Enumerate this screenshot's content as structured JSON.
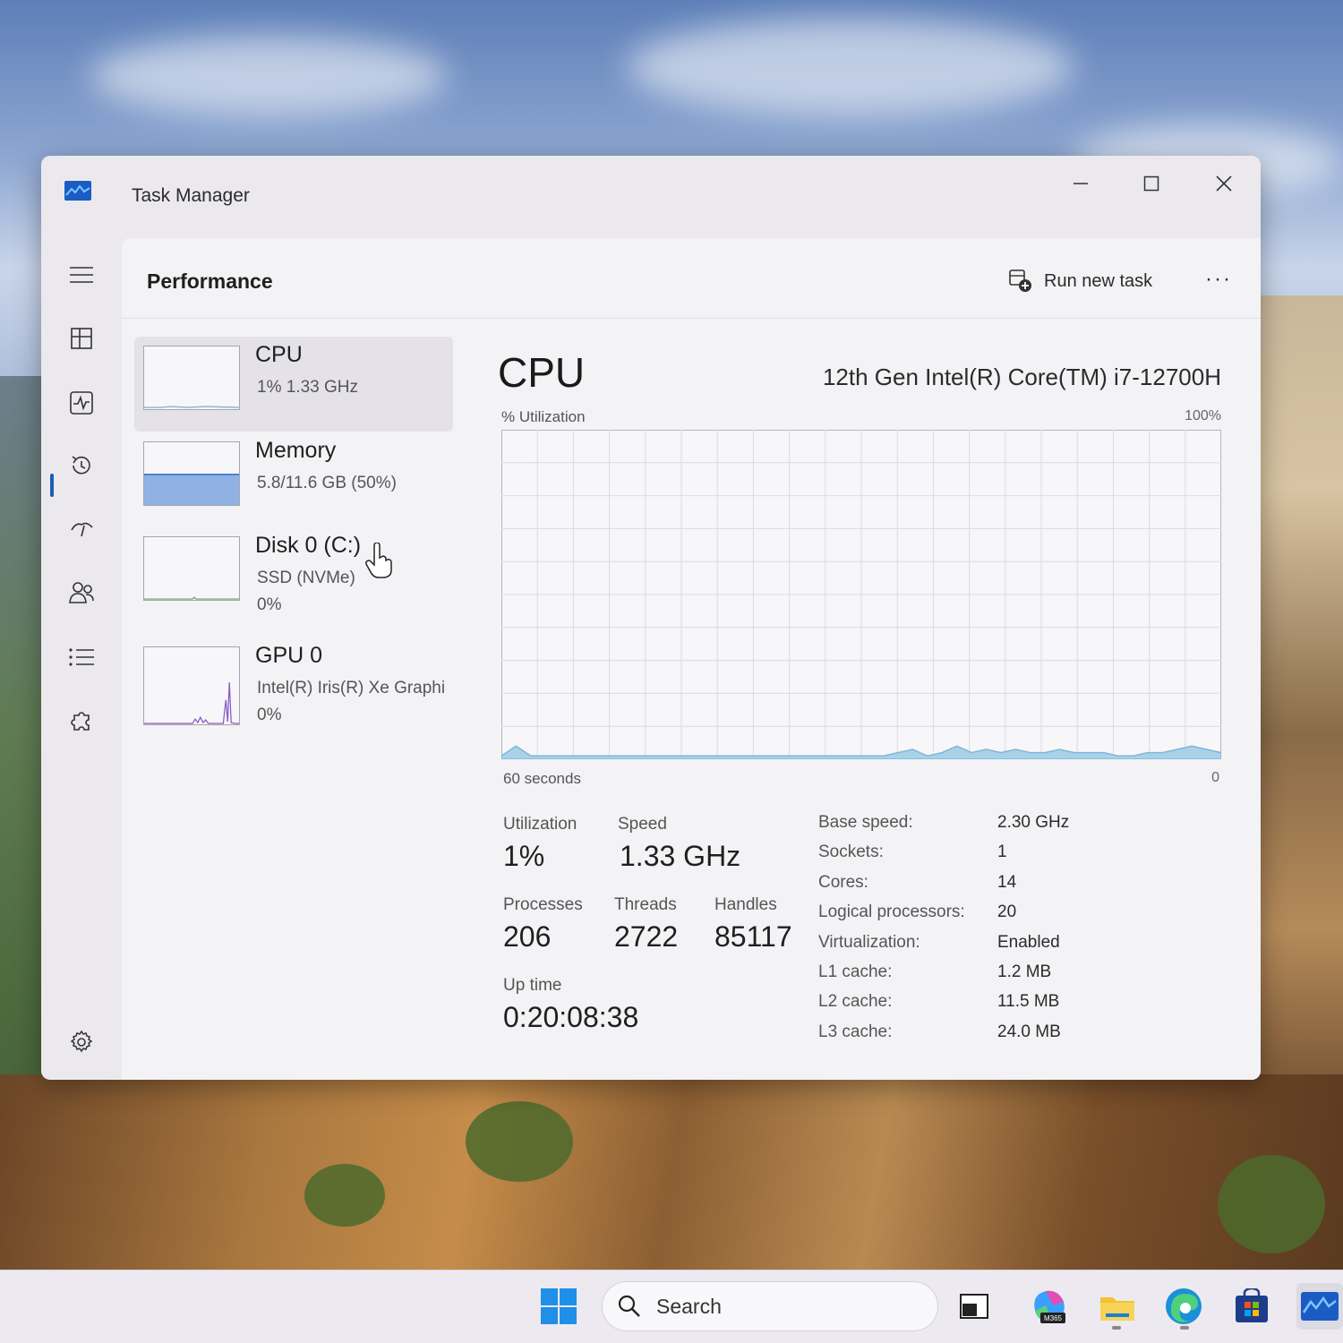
{
  "window": {
    "title": "Task Manager",
    "page_title": "Performance",
    "run_new_task": "Run new task",
    "more": "···"
  },
  "nav": {
    "items": [
      "menu",
      "processes",
      "performance",
      "app-history",
      "startup-apps",
      "users",
      "details",
      "services",
      "settings"
    ],
    "selected": "performance"
  },
  "devices": [
    {
      "name": "CPU",
      "sub": "1%  1.33 GHz",
      "sub2": ""
    },
    {
      "name": "Memory",
      "sub": "5.8/11.6 GB (50%)",
      "sub2": "",
      "fill_fraction": 0.5
    },
    {
      "name": "Disk 0 (C:)",
      "sub": "SSD (NVMe)",
      "sub2": "0%"
    },
    {
      "name": "GPU 0",
      "sub": "Intel(R) Iris(R) Xe Graphi",
      "sub2": "0%"
    }
  ],
  "detail": {
    "title": "CPU",
    "model": "12th Gen Intel(R) Core(TM) i7-12700H",
    "util_label": "% Utilization",
    "util_max": "100%",
    "axis_left": "60 seconds",
    "axis_right": "0",
    "stats": {
      "utilization_label": "Utilization",
      "utilization": "1%",
      "speed_label": "Speed",
      "speed": "1.33 GHz",
      "processes_label": "Processes",
      "processes": "206",
      "threads_label": "Threads",
      "threads": "2722",
      "handles_label": "Handles",
      "handles": "85117",
      "uptime_label": "Up time",
      "uptime": "0:20:08:38"
    },
    "specs": [
      {
        "label": "Base speed:",
        "value": "2.30 GHz"
      },
      {
        "label": "Sockets:",
        "value": "1"
      },
      {
        "label": "Cores:",
        "value": "14"
      },
      {
        "label": "Logical processors:",
        "value": "20"
      },
      {
        "label": "Virtualization:",
        "value": "Enabled"
      },
      {
        "label": "L1 cache:",
        "value": "1.2 MB"
      },
      {
        "label": "L2 cache:",
        "value": "11.5 MB"
      },
      {
        "label": "L3 cache:",
        "value": "24.0 MB"
      }
    ]
  },
  "cpu_history_percent": [
    1,
    4,
    1,
    1,
    1,
    1,
    1,
    1,
    1,
    1,
    1,
    1,
    1,
    1,
    1,
    1,
    1,
    1,
    1,
    1,
    1,
    1,
    1,
    1,
    1,
    1,
    1,
    2,
    3,
    1,
    2,
    4,
    2,
    3,
    2,
    3,
    2,
    2,
    3,
    2,
    2,
    2,
    1,
    1,
    2,
    2,
    3,
    4,
    3,
    2
  ],
  "taskbar": {
    "search_placeholder": "Search",
    "items": [
      "start-icon",
      "search",
      "widgets-icon",
      "m365-copilot-icon",
      "file-explorer-icon",
      "edge-icon",
      "microsoft-store-icon",
      "task-manager-icon"
    ],
    "m365_label": "M365"
  },
  "colors": {
    "accent": "#1a5fb4",
    "cpu_graph": "#7fb7d6",
    "memory_fill": "#8fb1e4",
    "gpu_graph": "#8a5cc7"
  }
}
